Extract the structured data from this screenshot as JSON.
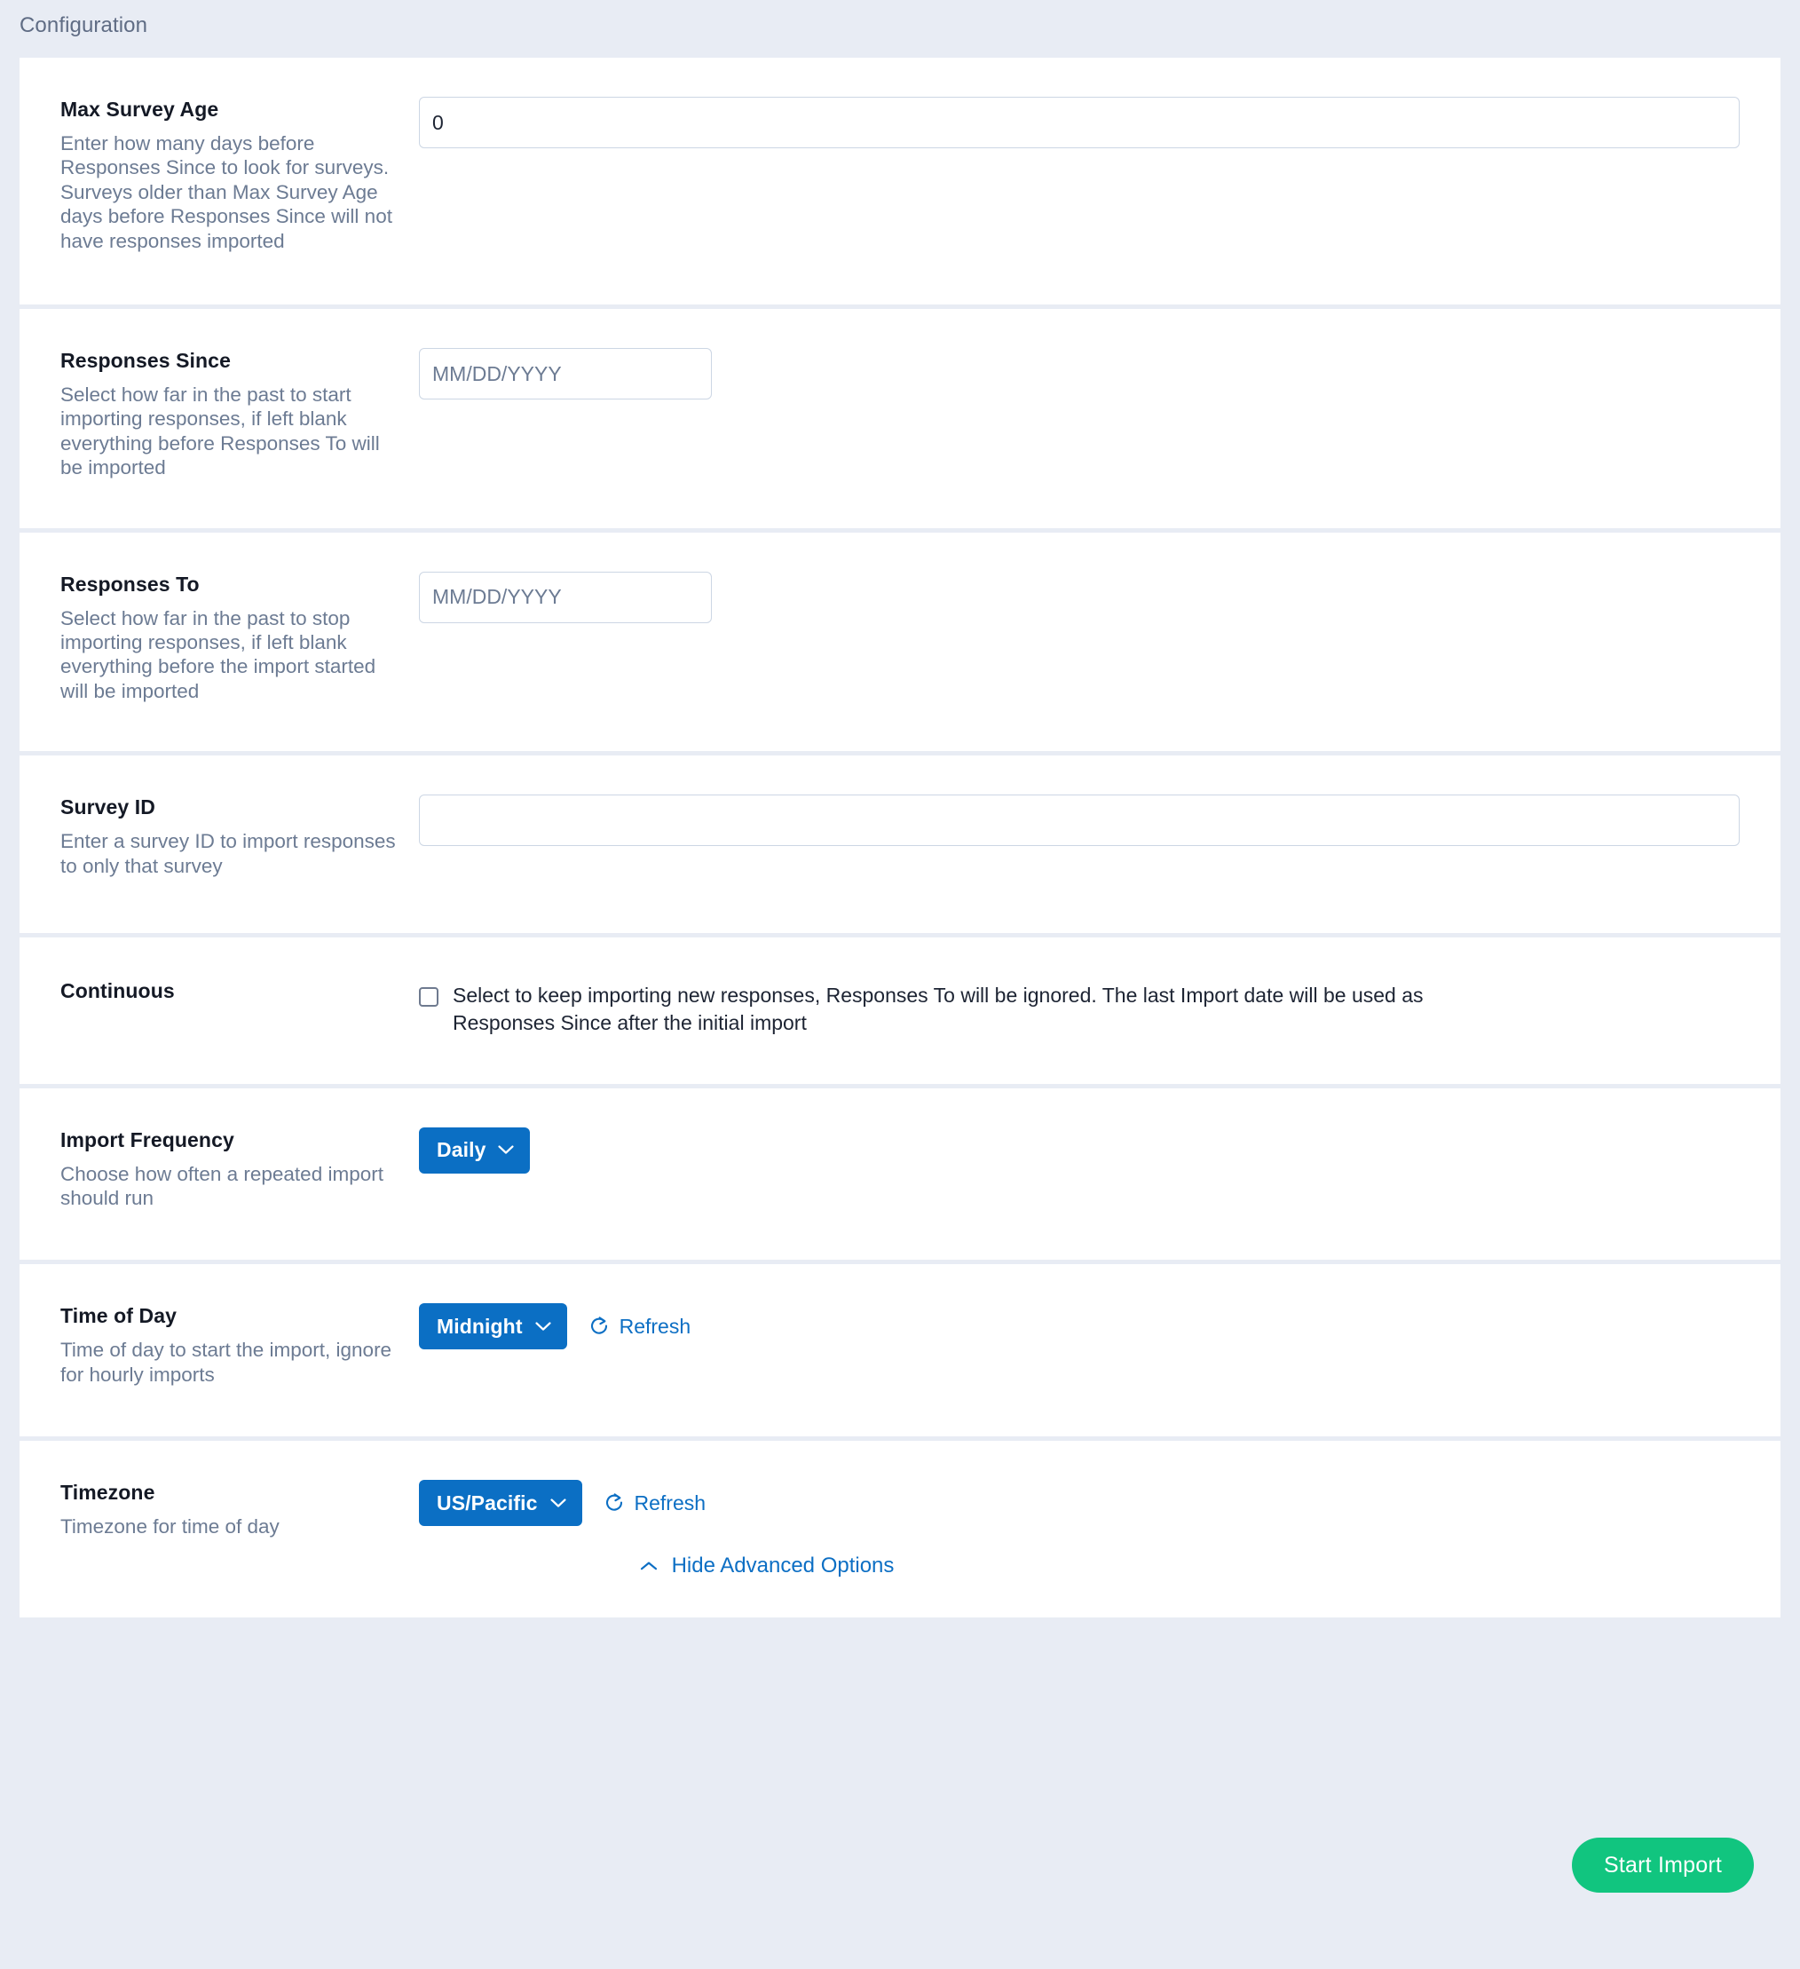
{
  "section": {
    "title": "Configuration"
  },
  "fields": {
    "max_survey_age": {
      "label": "Max Survey Age",
      "description": "Enter how many days before Responses Since to look for surveys. Surveys older than Max Survey Age days before Responses Since will not have responses imported",
      "value": "0",
      "placeholder": ""
    },
    "responses_since": {
      "label": "Responses Since",
      "description": "Select how far in the past to start importing responses, if left blank everything before Responses To will be imported",
      "value": "",
      "placeholder": "MM/DD/YYYY"
    },
    "responses_to": {
      "label": "Responses To",
      "description": "Select how far in the past to stop importing responses, if left blank everything before the import started will be imported",
      "value": "",
      "placeholder": "MM/DD/YYYY"
    },
    "survey_id": {
      "label": "Survey ID",
      "description": "Enter a survey ID to import responses to only that survey",
      "value": "",
      "placeholder": ""
    },
    "continuous": {
      "label": "Continuous",
      "checkbox_text": "Select to keep importing new responses, Responses To will be ignored. The last Import date will be used as Responses Since after the initial import",
      "checked": false
    },
    "import_frequency": {
      "label": "Import Frequency",
      "description": "Choose how often a repeated import should run",
      "selected": "Daily"
    },
    "time_of_day": {
      "label": "Time of Day",
      "description": "Time of day to start the import, ignore for hourly imports",
      "selected": "Midnight",
      "refresh_label": "Refresh"
    },
    "timezone": {
      "label": "Timezone",
      "description": "Timezone for time of day",
      "selected": "US/Pacific",
      "refresh_label": "Refresh"
    }
  },
  "advanced_toggle": {
    "label": "Hide Advanced Options"
  },
  "footer": {
    "start_import_label": "Start Import"
  },
  "colors": {
    "page_background": "#e8ecf4",
    "card_background": "#ffffff",
    "dropdown_blue": "#0b6fc4",
    "link_blue": "#0d6fc4",
    "primary_green": "#11c57f",
    "label_text": "#141925",
    "description_text": "#6c7b93",
    "section_title": "#5f6c84",
    "input_border": "#ccd6e4"
  }
}
